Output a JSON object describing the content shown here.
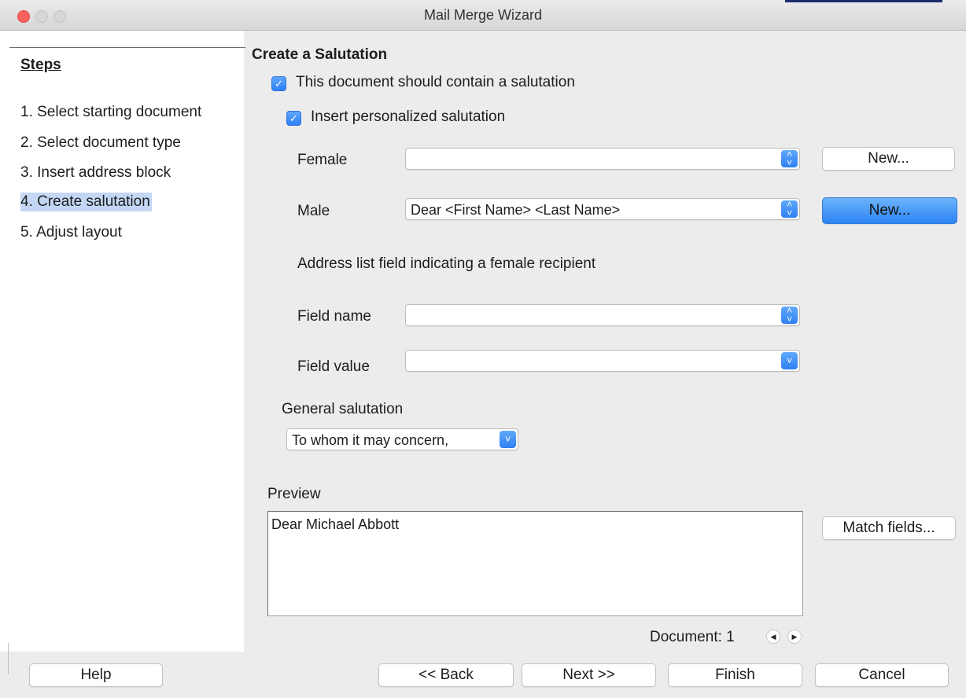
{
  "window": {
    "title": "Mail Merge Wizard"
  },
  "steps": {
    "title": "Steps",
    "items": [
      {
        "label": "1. Select starting document"
      },
      {
        "label": "2. Select document type"
      },
      {
        "label": "3. Insert address block"
      },
      {
        "label": "4. Create salutation",
        "selected": true
      },
      {
        "label": "5. Adjust layout"
      }
    ]
  },
  "page": {
    "heading": "Create a Salutation",
    "contain_salutation": {
      "label": "This document should contain a salutation",
      "checked": true
    },
    "personalized": {
      "label": "Insert personalized salutation",
      "checked": true
    },
    "female": {
      "label": "Female",
      "value": "",
      "new_button": "New..."
    },
    "male": {
      "label": "Male",
      "value": "Dear  <First Name> <Last Name>",
      "new_button": "New..."
    },
    "address_list_note": "Address list field indicating a female recipient",
    "field_name": {
      "label": "Field name",
      "value": ""
    },
    "field_value": {
      "label": "Field value",
      "value": ""
    },
    "general": {
      "label": "General salutation",
      "value": "To whom it may concern,"
    },
    "preview": {
      "label": "Preview",
      "text": "Dear  Michael Abbott",
      "match_button": "Match fields..."
    },
    "document": {
      "label": "Document:",
      "number": "1"
    }
  },
  "footer": {
    "help": "Help",
    "back": "<< Back",
    "next": "Next >>",
    "finish": "Finish",
    "cancel": "Cancel"
  },
  "colors": {
    "accent": "#2f80f4",
    "selected_step": "#c3d7f5"
  }
}
